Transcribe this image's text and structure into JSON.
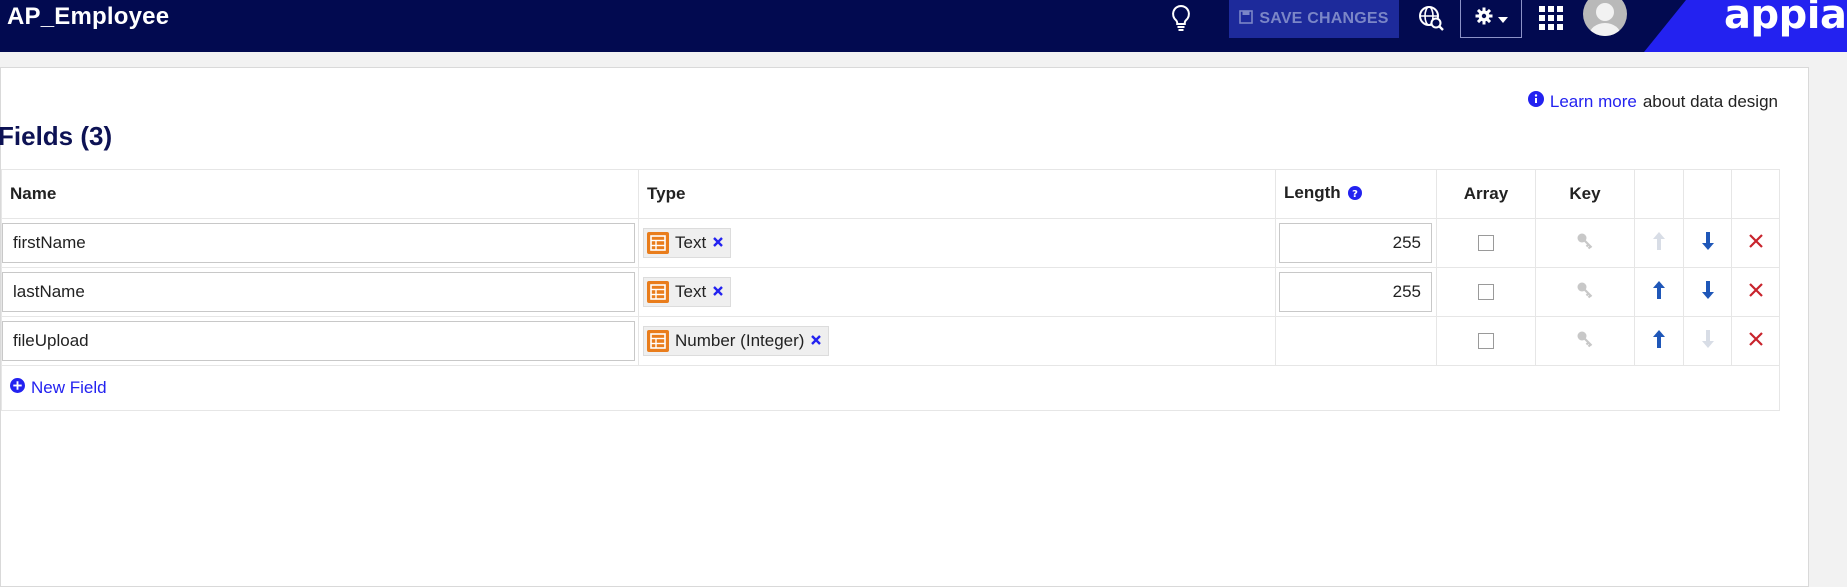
{
  "header": {
    "app_title": "AP_Employee",
    "save_label": "SAVE CHANGES",
    "brand": "appian",
    "icons": [
      "lightbulb-icon",
      "save-icon",
      "globe-search-icon",
      "gear-icon",
      "apps-grid-icon",
      "avatar"
    ]
  },
  "panel": {
    "learn_more_link": "Learn more",
    "learn_more_suffix": "about data design",
    "section_title": "Fields (3)",
    "columns": {
      "name": "Name",
      "type": "Type",
      "length": "Length",
      "array": "Array",
      "key": "Key"
    },
    "rows": [
      {
        "name": "firstName",
        "type": "Text",
        "length": "255",
        "array": false,
        "up_enabled": false,
        "down_enabled": true
      },
      {
        "name": "lastName",
        "type": "Text",
        "length": "255",
        "array": false,
        "up_enabled": true,
        "down_enabled": true
      },
      {
        "name": "fileUpload",
        "type": "Number (Integer)",
        "length": "",
        "array": false,
        "up_enabled": true,
        "down_enabled": false
      }
    ],
    "new_field_label": "New Field"
  },
  "colors": {
    "header_bg": "#020a50",
    "accent": "#2322f0",
    "type_icon": "#e97d1c",
    "delete": "#c8232c",
    "arrow_enabled": "#1f57b8",
    "arrow_disabled": "#d8dde6"
  }
}
